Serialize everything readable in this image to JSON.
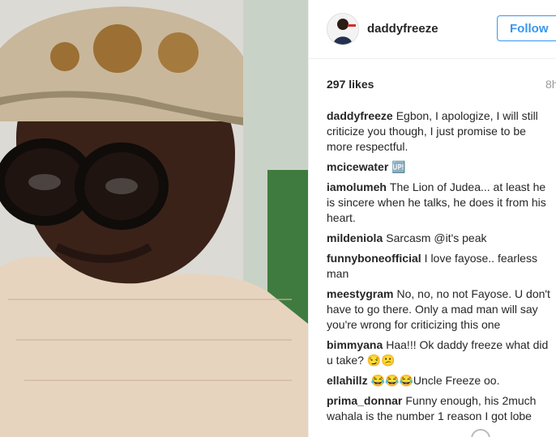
{
  "post": {
    "username": "daddyfreeze",
    "follow_label": "Follow",
    "likes": "297 likes",
    "time": "8h"
  },
  "comments": [
    {
      "user": "daddyfreeze",
      "text": "Egbon, I apologize, I will still criticize you though, I just promise to be more respectful."
    },
    {
      "user": "mcicewater",
      "text": "🆙"
    },
    {
      "user": "iamolumeh",
      "text": "The Lion of Judea... at least he is sincere when he talks, he does it from his heart."
    },
    {
      "user": "mildeniola",
      "text": "Sarcasm @it's peak"
    },
    {
      "user": "funnyboneofficial",
      "text": "I love fayose.. fearless man"
    },
    {
      "user": "meestygram",
      "text": "No, no, no not Fayose. U don't have to go there. Only a mad man will say you're wrong for criticizing this one"
    },
    {
      "user": "bimmyana",
      "text": "Haa!!! Ok daddy freeze what did u take? 😏😕"
    },
    {
      "user": "ellahillz",
      "text": "😂😂😂Uncle Freeze oo."
    },
    {
      "user": "prima_donnar",
      "text": "Funny enough, his 2much wahala is the number 1 reason I got lobe"
    }
  ]
}
